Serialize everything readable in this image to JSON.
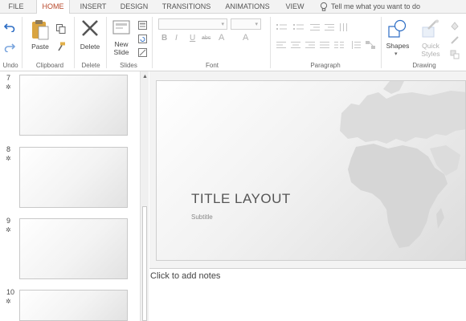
{
  "tabs": [
    {
      "label": "FILE"
    },
    {
      "label": "HOME"
    },
    {
      "label": "INSERT"
    },
    {
      "label": "DESIGN"
    },
    {
      "label": "TRANSITIONS"
    },
    {
      "label": "ANIMATIONS"
    },
    {
      "label": "VIEW"
    }
  ],
  "active_tab": "HOME",
  "tell_me": "Tell me what you want to do",
  "ribbon": {
    "paste_label": "Paste",
    "delete_label": "Delete",
    "new_slide_label": [
      "New",
      "Slide"
    ],
    "shapes_label": "Shapes",
    "quick_styles_label": [
      "Quick",
      "Styles"
    ],
    "groups": {
      "undo": "Undo",
      "clipboard": "Clipboard",
      "delete": "Delete",
      "slides": "Slides",
      "font": "Font",
      "paragraph": "Paragraph",
      "drawing": "Drawing"
    },
    "font_buttons": [
      "B",
      "I",
      "U",
      "abc",
      "A",
      "A"
    ]
  },
  "slides": [
    {
      "number": "7"
    },
    {
      "number": "8"
    },
    {
      "number": "9"
    },
    {
      "number": "10"
    }
  ],
  "current_slide": {
    "title": "TITLE LAYOUT",
    "subtitle": "Subtitle"
  },
  "notes_placeholder": "Click to add notes",
  "colors": {
    "accent": "#b7472a",
    "ribbon_bg": "#ffffff",
    "tabbar_bg": "#f3f3f3",
    "editor_bg": "#f3f3f3"
  }
}
